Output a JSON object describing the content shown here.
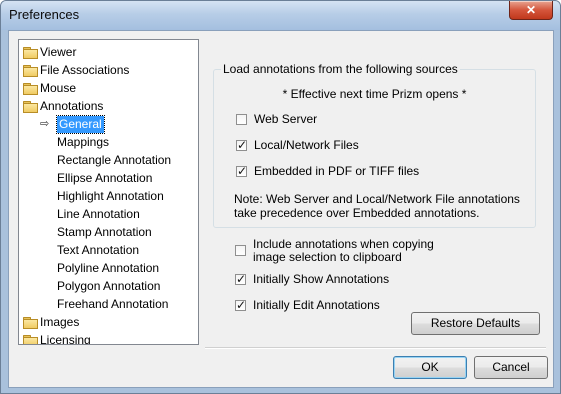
{
  "window": {
    "title": "Preferences",
    "close_glyph": "✕"
  },
  "tree": {
    "items": [
      {
        "label": "Viewer"
      },
      {
        "label": "File Associations"
      },
      {
        "label": "Mouse"
      },
      {
        "label": "Annotations"
      },
      {
        "label": "General"
      },
      {
        "label": "Mappings"
      },
      {
        "label": "Rectangle Annotation"
      },
      {
        "label": "Ellipse Annotation"
      },
      {
        "label": "Highlight Annotation"
      },
      {
        "label": "Line Annotation"
      },
      {
        "label": "Stamp Annotation"
      },
      {
        "label": "Text Annotation"
      },
      {
        "label": "Polyline Annotation"
      },
      {
        "label": "Polygon Annotation"
      },
      {
        "label": "Freehand Annotation"
      },
      {
        "label": "Images"
      },
      {
        "label": "Licensing"
      }
    ],
    "selected": "General",
    "selected_arrow": "⇨"
  },
  "sources": {
    "legend": "Load annotations from the following sources",
    "effective_note": "* Effective next time Prizm opens *",
    "web_server": {
      "label": "Web Server",
      "checked": false
    },
    "local_network": {
      "label": "Local/Network Files",
      "checked": true
    },
    "embedded": {
      "label": "Embedded in PDF or TIFF files",
      "checked": true
    },
    "note": "Note: Web Server and Local/Network File annotations take precedence over Embedded annotations."
  },
  "options": {
    "include_copy": {
      "label": "Include annotations when copying image selection to clipboard",
      "checked": false
    },
    "initially_show": {
      "label": "Initially Show Annotations",
      "checked": true
    },
    "initially_edit": {
      "label": "Initially Edit Annotations",
      "checked": true
    }
  },
  "buttons": {
    "restore_defaults": "Restore Defaults",
    "ok": "OK",
    "cancel": "Cancel"
  }
}
